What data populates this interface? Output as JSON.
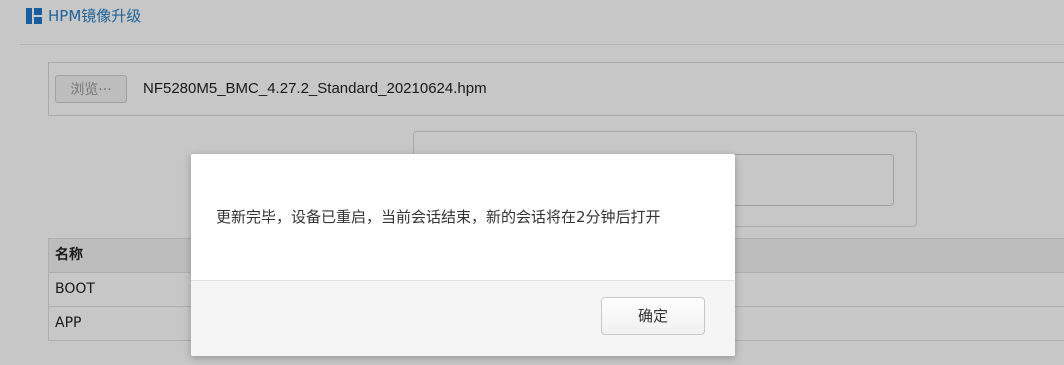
{
  "section": {
    "title": "HPM镜像升级",
    "icon": "module-icon",
    "accent_color": "#1f78c8"
  },
  "upload": {
    "browse_label": "浏览···",
    "file_name": "NF5280M5_BMC_4.27.2_Standard_20210624.hpm"
  },
  "table": {
    "header": "名称",
    "rows": [
      "BOOT",
      "APP"
    ]
  },
  "dialog": {
    "message": "更新完毕，设备已重启，当前会话结束，新的会话将在2分钟后打开",
    "confirm_label": "确定"
  }
}
